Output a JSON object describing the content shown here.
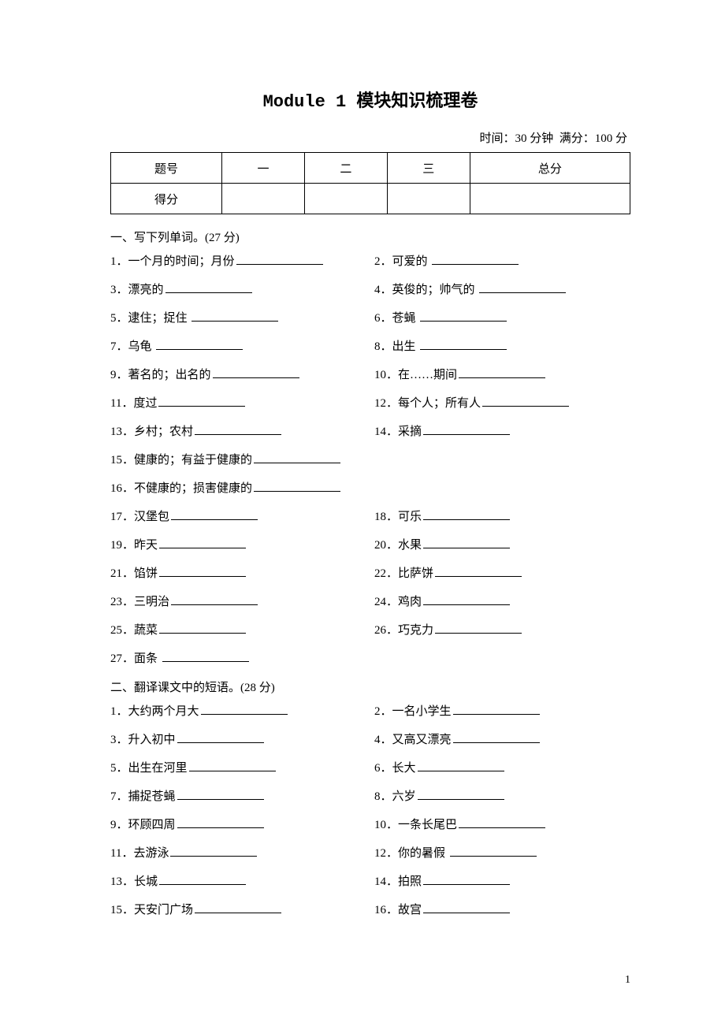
{
  "title": "Module 1 模块知识梳理卷",
  "meta_time_label": "时间：",
  "meta_time_value": "30 分钟",
  "meta_full_label": "满分：",
  "meta_full_value": "100 分",
  "table": {
    "row1": {
      "c1": "题号",
      "c2": "一",
      "c3": "二",
      "c4": "三",
      "c5": "总分"
    },
    "row2": {
      "c1": "得分",
      "c2": "",
      "c3": "",
      "c4": "",
      "c5": ""
    }
  },
  "section1_heading": "一、写下列单词。(27 分)",
  "section1": [
    {
      "l_num": "1．",
      "l_text": "一个月的时间；月份",
      "r_num": "2．",
      "r_text": "可爱的 "
    },
    {
      "l_num": "3．",
      "l_text": "漂亮的",
      "r_num": "4．",
      "r_text": "英俊的；帅气的 "
    },
    {
      "l_num": "5．",
      "l_text": "逮住；捉住 ",
      "r_num": "6．",
      "r_text": "苍蝇 "
    },
    {
      "l_num": "7．",
      "l_text": "乌龟 ",
      "r_num": "8．",
      "r_text": "出生 "
    },
    {
      "l_num": "9．",
      "l_text": "著名的；出名的",
      "r_num": "10．",
      "r_text": "在……期间"
    },
    {
      "l_num": "11．",
      "l_text": "度过",
      "r_num": "12．",
      "r_text": "每个人；所有人"
    },
    {
      "l_num": "13．",
      "l_text": "乡村；农村",
      "r_num": "14．",
      "r_text": "采摘"
    },
    {
      "l_num": "15．",
      "l_text": "健康的；有益于健康的",
      "r_num": "",
      "r_text": ""
    },
    {
      "l_num": "16．",
      "l_text": "不健康的；损害健康的",
      "r_num": "",
      "r_text": ""
    },
    {
      "l_num": "17．",
      "l_text": "汉堡包",
      "r_num": "18．",
      "r_text": "可乐"
    },
    {
      "l_num": "19．",
      "l_text": "昨天",
      "r_num": "20．",
      "r_text": "水果"
    },
    {
      "l_num": "21．",
      "l_text": "馅饼",
      "r_num": "22．",
      "r_text": "比萨饼"
    },
    {
      "l_num": "23．",
      "l_text": "三明治",
      "r_num": "24．",
      "r_text": "鸡肉"
    },
    {
      "l_num": "25．",
      "l_text": "蔬菜",
      "r_num": "26．",
      "r_text": "巧克力"
    },
    {
      "l_num": "27．",
      "l_text": "面条 ",
      "r_num": "",
      "r_text": ""
    }
  ],
  "section2_heading": "二、翻译课文中的短语。(28 分)",
  "section2": [
    {
      "l_num": "1．",
      "l_text": "大约两个月大",
      "r_num": "2．",
      "r_text": "一名小学生"
    },
    {
      "l_num": "3．",
      "l_text": "升入初中",
      "r_num": "4．",
      "r_text": "又高又漂亮"
    },
    {
      "l_num": "5．",
      "l_text": "出生在河里",
      "r_num": "6．",
      "r_text": "长大"
    },
    {
      "l_num": "7．",
      "l_text": "捕捉苍蝇",
      "r_num": "8．",
      "r_text": "六岁"
    },
    {
      "l_num": "9．",
      "l_text": "环顾四周",
      "r_num": "10．",
      "r_text": "一条长尾巴"
    },
    {
      "l_num": "11．",
      "l_text": "去游泳",
      "r_num": "12．",
      "r_text": "你的暑假 "
    },
    {
      "l_num": "13．",
      "l_text": "长城",
      "r_num": "14．",
      "r_text": "拍照"
    },
    {
      "l_num": "15．",
      "l_text": "天安门广场",
      "r_num": "16．",
      "r_text": "故宫"
    }
  ],
  "page_number": "1"
}
